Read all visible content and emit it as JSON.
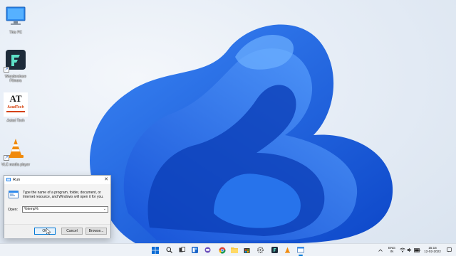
{
  "desktop": {
    "icons": [
      {
        "label": "This PC",
        "icon": "monitor-icon"
      },
      {
        "label": "Wondershare Filmora",
        "icon": "filmora-icon"
      },
      {
        "label": "Aztad Tech",
        "icon": "aztadtech-logo"
      },
      {
        "label": "VLC media player",
        "icon": "vlc-cone-icon"
      }
    ],
    "aztad_logo_text": "AT",
    "aztad_logo_sub": "AzadTech"
  },
  "run_dialog": {
    "title": "Run",
    "description": "Type the name of a program, folder, document, or Internet resource, and Windows will open it for you.",
    "open_label": "Open:",
    "open_value": "%temp%",
    "ok_label": "OK",
    "cancel_label": "Cancel",
    "browse_label": "Browse..."
  },
  "taskbar": {
    "language_line1": "ENG",
    "language_line2": "IN",
    "time": "15:15",
    "date": "12-02-2022",
    "icons": [
      "windows-start-icon",
      "search-icon",
      "task-view-icon",
      "widgets-icon",
      "chat-icon",
      "chrome-icon",
      "file-explorer-icon",
      "store-icon",
      "settings-icon",
      "filmora-taskbar-icon",
      "vlc-taskbar-icon",
      "run-taskbar-icon"
    ]
  },
  "colors": {
    "accent": "#0078d7",
    "wallpaper_bloom": "#1f6be8",
    "taskbar": "#eef2f7"
  }
}
